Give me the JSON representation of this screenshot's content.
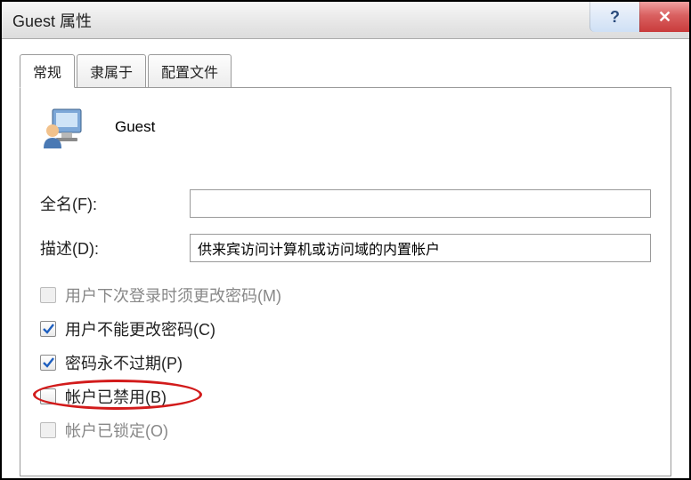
{
  "window": {
    "title": "Guest 属性",
    "help_symbol": "?",
    "close_symbol": "✕"
  },
  "tabs": [
    {
      "label": "常规",
      "active": true
    },
    {
      "label": "隶属于",
      "active": false
    },
    {
      "label": "配置文件",
      "active": false
    }
  ],
  "user": {
    "name": "Guest"
  },
  "fields": {
    "fullname_label": "全名(F):",
    "fullname_value": "",
    "description_label": "描述(D):",
    "description_value": "供来宾访问计算机或访问域的内置帐户"
  },
  "checkboxes": [
    {
      "label": "用户下次登录时须更改密码(M)",
      "checked": false,
      "disabled": true
    },
    {
      "label": "用户不能更改密码(C)",
      "checked": true,
      "disabled": false
    },
    {
      "label": "密码永不过期(P)",
      "checked": true,
      "disabled": false
    },
    {
      "label": "帐户已禁用(B)",
      "checked": false,
      "disabled": false,
      "highlighted": true
    },
    {
      "label": "帐户已锁定(O)",
      "checked": false,
      "disabled": true
    }
  ]
}
